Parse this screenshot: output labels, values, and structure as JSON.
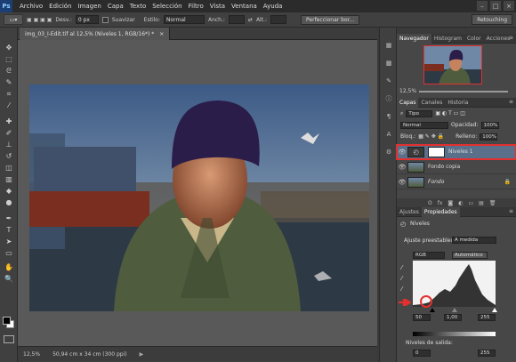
{
  "app": {
    "logo": "Ps"
  },
  "menu": [
    "Archivo",
    "Edición",
    "Imagen",
    "Capa",
    "Texto",
    "Selección",
    "Filtro",
    "Vista",
    "Ventana",
    "Ayuda"
  ],
  "window_controls": [
    "–",
    "□",
    "×"
  ],
  "options": {
    "desv_label": "Desv.:",
    "desv_value": "0 px",
    "suavizar": "Suavizar",
    "estilo_label": "Estilo:",
    "estilo_value": "Normal",
    "anch_label": "Anch.:",
    "alt_label": "Alt.:",
    "refine_button": "Perfeccionar bor...",
    "workspace": "Retouching"
  },
  "document": {
    "tab_title": "img_03_I-Edit.tif al 12,5% (Niveles 1, RGB/16*) *",
    "tab_close": "×",
    "zoom": "12,5%",
    "doc_size": "50,94 cm x 34 cm (300 ppi)"
  },
  "navigator": {
    "tabs": [
      "Navegador",
      "Histogram",
      "Color",
      "Acciones"
    ],
    "zoom": "12,5%"
  },
  "layers": {
    "tabs": [
      "Capas",
      "Canales",
      "Historia"
    ],
    "filter_label": "Tipo",
    "blend_mode": "Normal",
    "opacity_label": "Opacidad:",
    "opacity_value": "100%",
    "lock_label": "Bloq.:",
    "fill_label": "Relleno:",
    "fill_value": "100%",
    "items": [
      {
        "name": "Niveles 1",
        "selected": true
      },
      {
        "name": "Fondo copia",
        "selected": false
      },
      {
        "name": "Fondo",
        "selected": false
      }
    ],
    "footer_icons": [
      "ʘ",
      "fx",
      "◙",
      "◐",
      "▭",
      "▤",
      "🗑"
    ]
  },
  "properties": {
    "tabs": [
      "Ajustes",
      "Propiedades"
    ],
    "title": "Niveles",
    "preset_label": "Ajuste preestablecido:",
    "preset_value": "A medida",
    "channel": "RGB",
    "auto_button": "Automático",
    "input_values": [
      "50",
      "1,00",
      "255"
    ],
    "output_label": "Niveles de salida:",
    "output_values": [
      "0",
      "255"
    ]
  },
  "colors": {
    "highlight_red": "#e2302f",
    "selection_blue": "#5a6f8a"
  }
}
